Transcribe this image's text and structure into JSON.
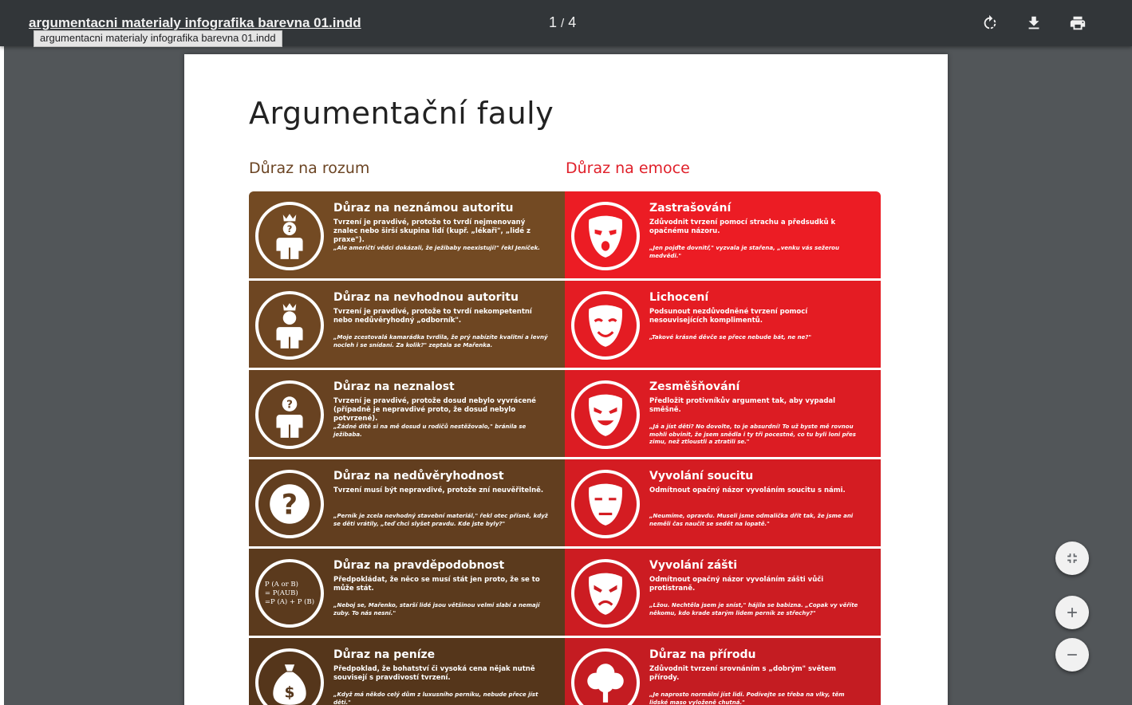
{
  "toolbar": {
    "doc_title": "argumentacni materialy infografika barevna 01.indd",
    "tooltip": "argumentacni materialy infografika barevna 01.indd",
    "page_current": "1",
    "page_sep": "/",
    "page_total": "4",
    "icons": [
      "rotate-icon",
      "download-icon",
      "print-icon"
    ]
  },
  "document": {
    "title": "Argumentační fauly",
    "left_heading": "Důraz na rozum",
    "right_heading": "Důraz na emoce",
    "left_cards": [
      {
        "title": "Důraz na neznámou autoritu",
        "desc": "Tvrzení je pravdivé, protože to tvrdí nejmenovaný znalec nebo širší skupina lidí (kupř. „lékaři\", „lidé z praxe\").",
        "example": "„Ale američtí vědci dokázali, že ježibaby neexistují!\" řekl Jeníček.",
        "icon": "crowned-person-question-icon",
        "color": "#734a23"
      },
      {
        "title": "Důraz na nevhodnou autoritu",
        "desc": "Tvrzení je pravdivé, protože to tvrdí nekompetentní nebo nedůvěryhodný „odborník\".",
        "example": "„Moje zcestovalá kamarádka tvrdila, že prý nabízíte kvalitní a levný nocleh i se snídaní. Za kolik?\" zeptala se Mařenka.",
        "icon": "crowned-person-icon",
        "color": "#6e4622"
      },
      {
        "title": "Důraz na neznalost",
        "desc": "Tvrzení je pravdivé, protože dosud nebylo vyvrácené (případně je nepravdivé proto, že dosud nebylo potvrzené).",
        "example": "„Žádné dítě si na mě dosud u rodičů nestěžovalo,\" bránila se ježibaba.",
        "icon": "person-question-icon",
        "color": "#684221"
      },
      {
        "title": "Důraz na nedůvěryhodnost",
        "desc": "Tvrzení musí být nepravdivé, protože zní neuvěřitelně.",
        "example": "„Perník je zcela nevhodný stavební materiál,\" řekl otec přísně, když se děti vrátily, „teď chci slyšet pravdu. Kde jste byly?\"",
        "icon": "question-mark-icon",
        "color": "#623e1f"
      },
      {
        "title": "Důraz na pravděpodobnost",
        "desc": "Předpokládat, že něco se musí stát jen proto, že se to může stát.",
        "example": "„Neboj se, Mařenko, starší lidé jsou většinou velmi slabí a nemají zuby. To nás nesní.\"",
        "icon": "probability-formula-icon",
        "formula": [
          "P (A or B)",
          "= P(AUB)",
          "=P (A) + P (B)"
        ],
        "color": "#5b3a1d"
      },
      {
        "title": "Důraz na peníze",
        "desc": "Předpoklad, že bohatství či vysoká cena nějak nutně souvisejí s pravdivostí tvrzení.",
        "example": "„Když má někdo celý dům z luxusního perníku, nebude přece jíst děti.\"",
        "icon": "money-bag-icon",
        "color": "#55361b"
      }
    ],
    "right_cards": [
      {
        "title": "Zastrašování",
        "desc": "Zdůvodnit tvrzení pomocí strachu a předsudků k opačnému názoru.",
        "example": "„Jen pojďte dovnitř,\" vyzvala je stařena, „venku vás sežerou medvědi.\"",
        "icon": "scared-mask-icon",
        "color": "#ec1c24"
      },
      {
        "title": "Lichocení",
        "desc": "Podsunout nezdůvodněné tvrzení pomocí nesouvisejících komplimentů.",
        "example": "„Takové krásné děvče se přece nebude bát, ne ne?\"",
        "icon": "smiling-mask-icon",
        "color": "#e41c23"
      },
      {
        "title": "Zesměšňování",
        "desc": "Předložit protivníkův argument tak, aby vypadal směšně.",
        "example": "„Já a jíst děti? No dovolte, to je absurdní! To už byste mě rovnou mohli obvinit, že jsem snědla i ty tři pocestné, co tu byli loni přes zimu, než ztloustli a ztratili se.\"",
        "icon": "mocking-mask-icon",
        "color": "#dc1c23"
      },
      {
        "title": "Vyvolání soucitu",
        "desc": "Odmítnout opačný názor vyvoláním soucitu s námi.",
        "example": "„Neumíme, opravdu. Museli jsme odmalička dřít tak, že jsme ani neměli čas naučit se sedět na lopatě.\"",
        "icon": "sad-mask-icon",
        "color": "#d41c22"
      },
      {
        "title": "Vyvolání zášti",
        "desc": "Odmítnout opačný názor vyvoláním zášti vůči protistraně.",
        "example": "„Lžou. Nechtěla jsem je sníst,\" hájila se babizna. „Copak vy věříte někomu, kdo krade starým lidem perník ze střechy?\"",
        "icon": "angry-mask-icon",
        "color": "#cc1c22"
      },
      {
        "title": "Důraz na přírodu",
        "desc": "Zdůvodnit tvrzení srovnáním s „dobrým\" světem přírody.",
        "example": "„Je naprosto normální jíst lidi. Podívejte se třeba na vlky, těm lidské maso vyloženě chutná.\"",
        "icon": "tree-icon",
        "color": "#c41c22"
      }
    ]
  },
  "controls": {
    "icons": [
      "fit-to-page-icon",
      "zoom-in-icon",
      "zoom-out-icon"
    ]
  }
}
